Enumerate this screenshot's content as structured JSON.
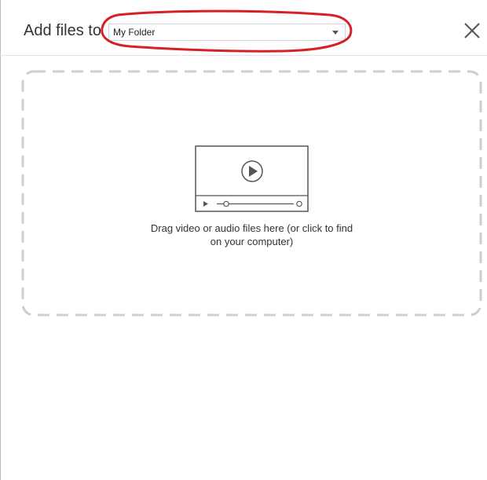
{
  "header": {
    "title": "Add files to",
    "folder_select": {
      "selected": "My Folder"
    }
  },
  "dropzone": {
    "text_line1": "Drag video or audio files here (or click to find",
    "text_line2": "on your computer)"
  },
  "icons": {
    "close": "close-icon",
    "video": "video-player-icon",
    "dropdown": "chevron-down-icon"
  },
  "colors": {
    "annotation": "#d62027",
    "dashed_border": "#cfcfcf",
    "icon": "#555555"
  }
}
